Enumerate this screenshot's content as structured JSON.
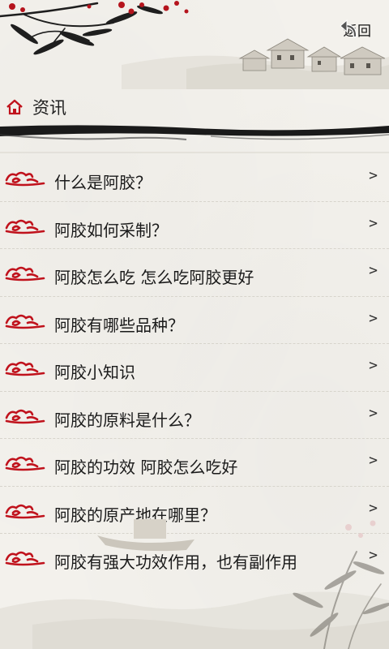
{
  "header": {
    "back_label": "返回"
  },
  "titlebar": {
    "title": "资讯"
  },
  "list": {
    "items": [
      {
        "label": "什么是阿胶？"
      },
      {
        "label": "阿胶如何采制？"
      },
      {
        "label": "阿胶怎么吃 怎么吃阿胶更好"
      },
      {
        "label": "阿胶有哪些品种？"
      },
      {
        "label": "阿胶小知识"
      },
      {
        "label": "阿胶的原料是什么？"
      },
      {
        "label": "阿胶的功效 阿胶怎么吃好"
      },
      {
        "label": "阿胶的原产地在哪里？"
      },
      {
        "label": "阿胶有强大功效作用，也有副作用"
      }
    ],
    "arrow_glyph": ">"
  },
  "colors": {
    "accent": "#c0121c",
    "ink": "#1a1a1a"
  },
  "icons": {
    "back": "back-arrow-icon",
    "home": "home-icon",
    "item": "cloud-icon",
    "arrow": "chevron-right-icon"
  }
}
